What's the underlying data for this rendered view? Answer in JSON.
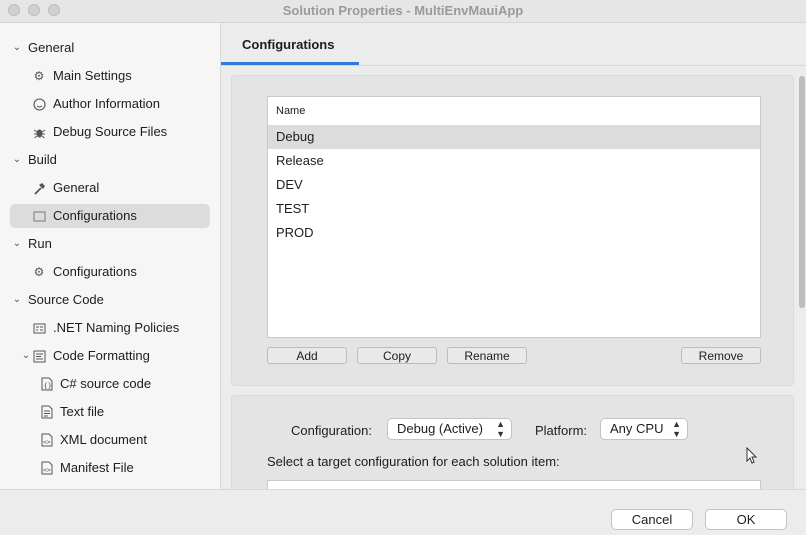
{
  "window": {
    "title": "Solution Properties - MultiEnvMauiApp"
  },
  "sidebar": {
    "items": [
      {
        "label": "General",
        "icon": "chevron-down-icon"
      },
      {
        "label": "Main Settings",
        "icon": "gear-icon"
      },
      {
        "label": "Author Information",
        "icon": "smiley-icon"
      },
      {
        "label": "Debug Source Files",
        "icon": "bug-icon"
      },
      {
        "label": "Build",
        "icon": "chevron-down-icon"
      },
      {
        "label": "General",
        "icon": "hammer-icon"
      },
      {
        "label": "Configurations",
        "icon": "window-icon"
      },
      {
        "label": "Run",
        "icon": "chevron-down-icon"
      },
      {
        "label": "Configurations",
        "icon": "gear-icon"
      },
      {
        "label": "Source Code",
        "icon": "chevron-down-icon"
      },
      {
        "label": ".NET Naming Policies",
        "icon": "naming-icon"
      },
      {
        "label": "Code Formatting",
        "icon": "format-icon"
      },
      {
        "label": "C# source code",
        "icon": "braces-file-icon"
      },
      {
        "label": "Text file",
        "icon": "text-file-icon"
      },
      {
        "label": "XML document",
        "icon": "code-file-icon"
      },
      {
        "label": "Manifest File",
        "icon": "code-file-icon"
      }
    ]
  },
  "main": {
    "tab_label": "Configurations",
    "list": {
      "header": "Name",
      "rows": [
        "Debug",
        "Release",
        "DEV",
        "TEST",
        "PROD"
      ],
      "selected": "Debug"
    },
    "buttons": {
      "add": "Add",
      "copy": "Copy",
      "rename": "Rename",
      "remove": "Remove"
    },
    "configuration_label": "Configuration:",
    "configuration_value": "Debug (Active)",
    "platform_label": "Platform:",
    "platform_value": "Any CPU",
    "target_text": "Select a target configuration for each solution item:"
  },
  "footer": {
    "cancel": "Cancel",
    "ok": "OK"
  },
  "colors": {
    "accent": "#2f7bd6",
    "selection": "#dcdcdc"
  }
}
